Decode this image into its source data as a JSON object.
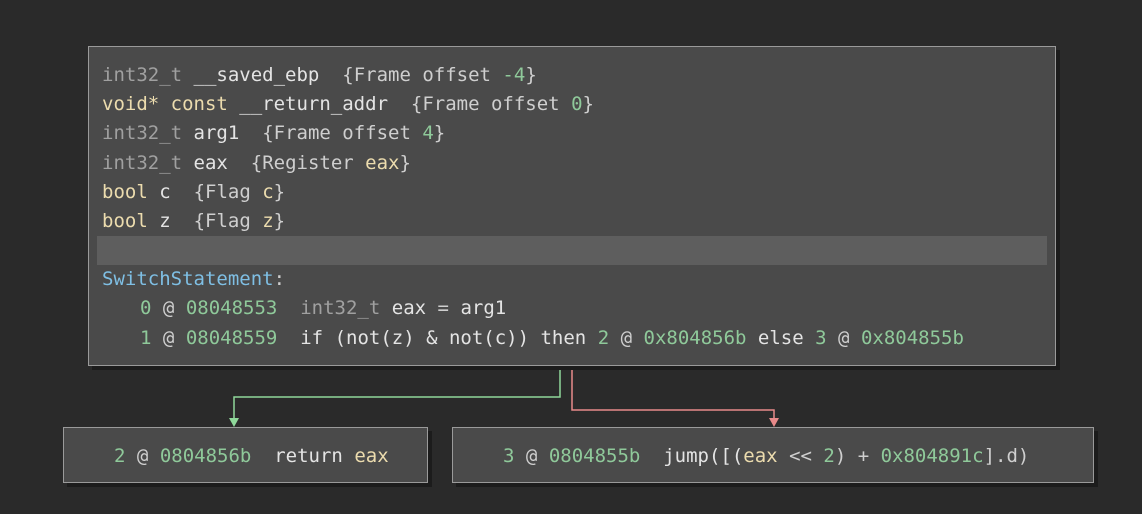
{
  "main_block": {
    "vars": [
      {
        "type": "int32_t",
        "name": "__saved_ebp",
        "loc_open": "{Frame offset ",
        "loc_val": "-4",
        "loc_close": "}"
      },
      {
        "type": "void* const",
        "name": "__return_addr",
        "loc_open": "{Frame offset ",
        "loc_val": "0",
        "loc_close": "}"
      },
      {
        "type": "int32_t",
        "name": "arg1",
        "loc_open": "{Frame offset ",
        "loc_val": "4",
        "loc_close": "}"
      },
      {
        "type": "int32_t",
        "name": "eax",
        "loc_open": "{Register ",
        "loc_val": "eax",
        "loc_close": "}"
      },
      {
        "type": "bool",
        "name": "c",
        "loc_open": "{Flag ",
        "loc_val": "c",
        "loc_close": "}"
      },
      {
        "type": "bool",
        "name": "z",
        "loc_open": "{Flag ",
        "loc_val": "z",
        "loc_close": "}"
      }
    ],
    "label": "SwitchStatement",
    "label_colon": ":",
    "instr": [
      {
        "index": "0",
        "at": "@",
        "addr": "08048553",
        "type": "int32_t",
        "dest": "eax",
        "op": "=",
        "src": "arg1"
      },
      {
        "index": "1",
        "at": "@",
        "addr": "08048559",
        "if_kw": "if",
        "cond": "(not(z) & not(c))",
        "then_kw": "then",
        "then_idx": "2",
        "then_at": "@",
        "then_addr": "0x804856b",
        "else_kw": "else",
        "else_idx": "3",
        "else_at": "@",
        "else_addr": "0x804855b"
      }
    ]
  },
  "true_block": {
    "index": "2",
    "at": "@",
    "addr": "0804856b",
    "kw": "return",
    "reg": "eax"
  },
  "false_block": {
    "index": "3",
    "at": "@",
    "addr": "0804855b",
    "kw_open": "jump([(",
    "reg": "eax",
    "op": " << ",
    "shift": "2",
    "plus": ") + ",
    "base": "0x804891c",
    "tail": "].d)"
  },
  "colors": {
    "true_edge": "#8fd89a",
    "false_edge": "#e88a8a"
  }
}
